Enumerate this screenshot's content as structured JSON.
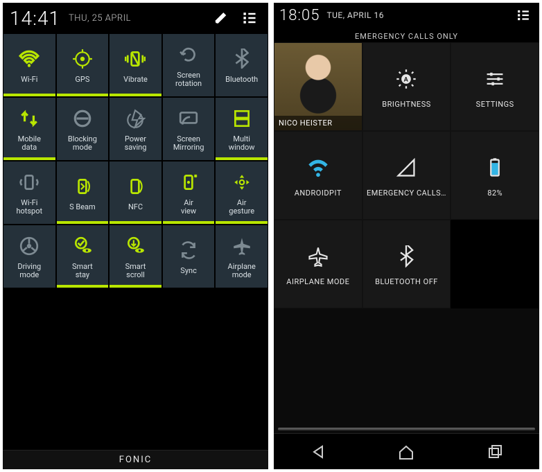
{
  "left": {
    "time": "14:41",
    "date": "THU, 25 APRIL",
    "carrier": "FONIC",
    "tiles": [
      {
        "label": "Wi-Fi",
        "icon": "wifi",
        "active": true
      },
      {
        "label": "GPS",
        "icon": "gps",
        "active": true
      },
      {
        "label": "Vibrate",
        "icon": "vibrate",
        "active": true
      },
      {
        "label": "Screen\nrotation",
        "icon": "rotate",
        "active": false
      },
      {
        "label": "Bluetooth",
        "icon": "bluetooth",
        "active": false
      },
      {
        "label": "Mobile\ndata",
        "icon": "mobile-data",
        "active": true
      },
      {
        "label": "Blocking\nmode",
        "icon": "blocking",
        "active": false
      },
      {
        "label": "Power\nsaving",
        "icon": "power-saving",
        "active": false
      },
      {
        "label": "Screen\nMirroring",
        "icon": "mirroring",
        "active": false
      },
      {
        "label": "Multi\nwindow",
        "icon": "multi-window",
        "active": true
      },
      {
        "label": "Wi-Fi\nhotspot",
        "icon": "hotspot",
        "active": false
      },
      {
        "label": "S Beam",
        "icon": "s-beam",
        "active": true
      },
      {
        "label": "NFC",
        "icon": "nfc",
        "active": true
      },
      {
        "label": "Air\nview",
        "icon": "air-view",
        "active": true
      },
      {
        "label": "Air\ngesture",
        "icon": "air-gesture",
        "active": true
      },
      {
        "label": "Driving\nmode",
        "icon": "driving",
        "active": false
      },
      {
        "label": "Smart\nstay",
        "icon": "smart-stay",
        "active": true
      },
      {
        "label": "Smart\nscroll",
        "icon": "smart-scroll",
        "active": true
      },
      {
        "label": "Sync",
        "icon": "sync",
        "active": false
      },
      {
        "label": "Airplane\nmode",
        "icon": "airplane",
        "active": false
      }
    ]
  },
  "right": {
    "time": "18:05",
    "date": "TUE, APRIL 16",
    "subtitle": "EMERGENCY CALLS ONLY",
    "user_name": "NICO HEISTER",
    "tiles": [
      {
        "label": "",
        "icon": "user",
        "type": "user"
      },
      {
        "label": "BRIGHTNESS",
        "icon": "brightness"
      },
      {
        "label": "SETTINGS",
        "icon": "settings"
      },
      {
        "label": "ANDROIDPIT",
        "icon": "wifi-blue"
      },
      {
        "label": "EMERGENCY CALLS…",
        "icon": "signal"
      },
      {
        "label": "82%",
        "icon": "battery"
      },
      {
        "label": "AIRPLANE MODE",
        "icon": "airplane-line"
      },
      {
        "label": "BLUETOOTH OFF",
        "icon": "bluetooth-line"
      }
    ]
  }
}
